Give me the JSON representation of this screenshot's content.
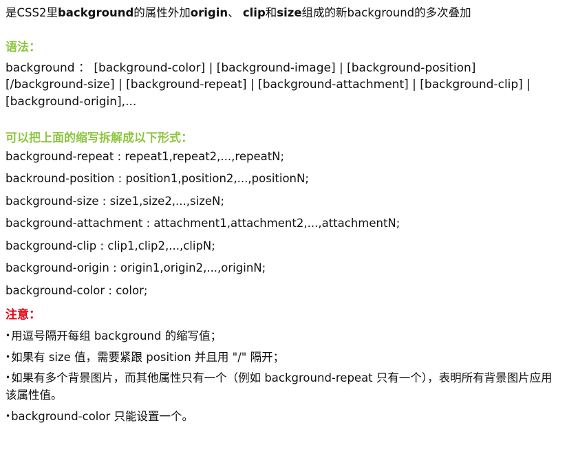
{
  "document": {
    "intro": {
      "segments": [
        {
          "text": "是CSS2里",
          "bold": false
        },
        {
          "text": "background",
          "bold": true
        },
        {
          "text": "的属性外加",
          "bold": false
        },
        {
          "text": "origin",
          "bold": true
        },
        {
          "text": "、 ",
          "bold": false
        },
        {
          "text": "clip",
          "bold": true
        },
        {
          "text": "和",
          "bold": false
        },
        {
          "text": "size",
          "bold": true
        },
        {
          "text": "组成的新background的多次叠加",
          "bold": false
        }
      ],
      "plain": "是CSS2里background的属性外加origin、 clip和size组成的新background的多次叠加"
    },
    "syntax_section": {
      "heading": "语法：",
      "heading_color": "#8dc63f",
      "body": "background ： [background-color] | [background-image] | [background-position][/background-size] | [background-repeat] | [background-attachment] | [background-clip] | [background-origin],..."
    },
    "expanded_section": {
      "heading": "可以把上面的缩写拆解成以下形式：",
      "heading_color": "#8dc63f",
      "properties": [
        "background-repeat : repeat1,repeat2,...,repeatN;",
        "backround-position : position1,position2,...,positionN;",
        "background-size : size1,size2,...,sizeN;",
        "background-attachment : attachment1,attachment2,...,attachmentN;",
        "background-clip : clip1,clip2,...,clipN;",
        "background-origin : origin1,origin2,...,originN;",
        "background-color : color;"
      ]
    },
    "notes_section": {
      "heading": "注意：",
      "heading_color": "#e60012",
      "notes": [
        "用逗号隔开每组 background 的缩写值；",
        "如果有 size 值，需要紧跟 position 并且用 \"/\" 隔开；",
        "如果有多个背景图片，而其他属性只有一个（例如 background-repeat 只有一个），表明所有背景图片应用该属性值。",
        "background-color 只能设置一个。"
      ]
    }
  }
}
